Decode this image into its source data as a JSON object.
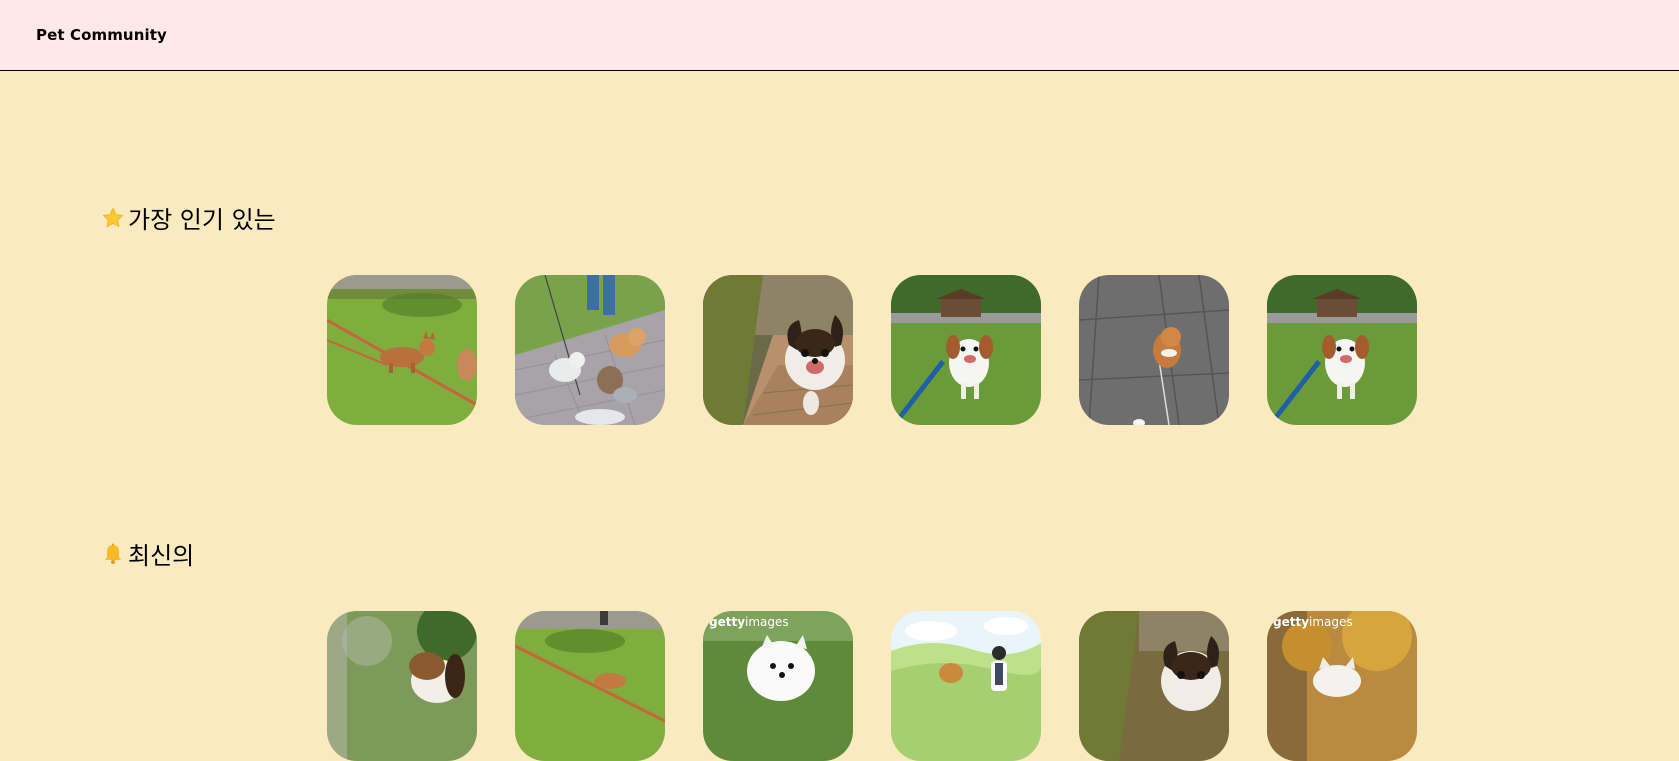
{
  "header": {
    "brand": "Pet Community"
  },
  "sections": {
    "popular": {
      "title": "가장 인기 있는",
      "icon": "star-icon",
      "items": [
        {
          "name": "corgi-on-grass"
        },
        {
          "name": "dogs-walking-on-pavement"
        },
        {
          "name": "happy-puppy-running"
        },
        {
          "name": "dog-on-park-lawn"
        },
        {
          "name": "small-dog-on-stone-path"
        },
        {
          "name": "dog-on-park-lawn"
        }
      ]
    },
    "latest": {
      "title": "최신의",
      "icon": "bell-icon",
      "items": [
        {
          "name": "beagle-in-garden"
        },
        {
          "name": "corgi-on-grass"
        },
        {
          "name": "white-spitz",
          "watermark": "gettyimages"
        },
        {
          "name": "illustration-woman-with-dog"
        },
        {
          "name": "happy-puppy-running"
        },
        {
          "name": "white-dog-autumn",
          "watermark": "gettyimages"
        }
      ]
    }
  },
  "colors": {
    "background": "#f9eac0",
    "header": "#ffe8e8"
  }
}
